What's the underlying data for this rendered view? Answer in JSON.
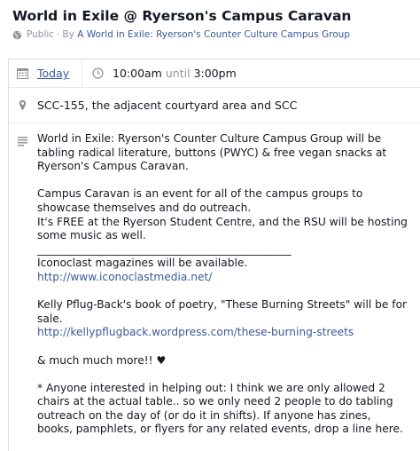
{
  "event": {
    "title": "World in Exile @ Ryerson's Campus Caravan",
    "privacy": "Public",
    "by_prefix": "By",
    "host": "A World in Exile: Ryerson's Counter Culture Campus Group"
  },
  "when": {
    "day": "Today",
    "start": "10:00am",
    "until": "until",
    "end": "3:00pm"
  },
  "where": {
    "location": "SCC-155, the adjacent courtyard area and SCC"
  },
  "description": {
    "p1": "World in Exile: Ryerson's Counter Culture Campus Group will be tabling radical literature, buttons (PWYC) & free vegan snacks at Ryerson's Campus Caravan.",
    "p2_line1": "Campus Caravan is an event for all of the campus groups to showcase themselves and do outreach.",
    "p2_line2": "It's FREE at the Ryerson Student Centre, and the RSU will be hosting some music as well.",
    "divider": "_______________________________________________",
    "p3_text": "Iconoclast magazines will be available.",
    "p3_link": "http://www.iconoclastmedia.net/",
    "p4_text": "Kelly Pflug-Back's book of poetry, \"These Burning Streets\" will be for sale.",
    "p4_link": "http://kellypflugback.wordpress.com/these-burning-streets",
    "p5": "& much much more!! ♥",
    "p6": "* Anyone interested in helping out: I think we are only allowed 2 chairs at the actual table.. so we only need 2 people to do tabling outreach on the day of (or do it in shifts). If anyone has zines, books, pamphlets, or flyers for any related events, drop a line here."
  },
  "icons": {
    "privacy": "globe-icon",
    "date": "calendar-icon",
    "time": "clock-icon",
    "location": "map-pin-icon",
    "details": "text-lines-icon"
  }
}
